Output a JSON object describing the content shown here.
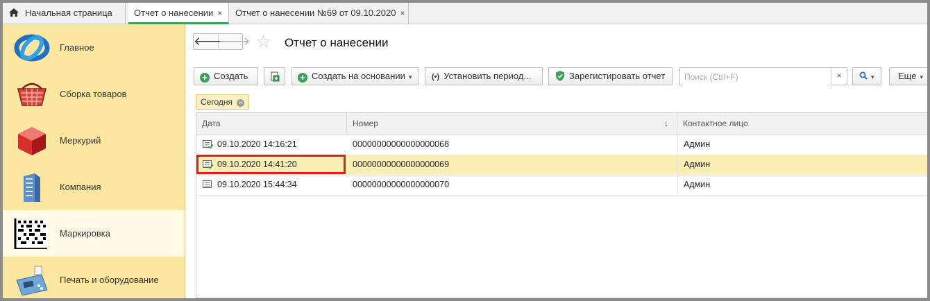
{
  "tabs": [
    {
      "label": "Начальная страница",
      "icon": "home-icon"
    },
    {
      "label": "Отчет о нанесении",
      "active": true
    },
    {
      "label": "Отчет о нанесении №69 от 09.10.2020"
    }
  ],
  "tab_close": "×",
  "sidebar": {
    "items": [
      {
        "label": "Главное",
        "icon": "main-swirl-icon"
      },
      {
        "label": "Сборка товаров",
        "icon": "basket-icon"
      },
      {
        "label": "Меркурий",
        "icon": "red-cube-icon"
      },
      {
        "label": "Компания",
        "icon": "building-icon"
      },
      {
        "label": "Маркировка",
        "icon": "datamatrix-icon",
        "selected": true
      },
      {
        "label": "Печать и оборудование",
        "icon": "cash-register-icon"
      }
    ]
  },
  "header": {
    "title": "Отчет о нанесении",
    "back": "🡐",
    "forward": "🡒",
    "star": "☆"
  },
  "toolbar": {
    "create": "Создать",
    "create_based": "Создать на основании",
    "set_period": "Установить период...",
    "register": "Зарегистировать отчет",
    "search_placeholder": "Поиск (Ctrl+F)",
    "search_clear": "×",
    "more": "Еще",
    "caret": "▾"
  },
  "filter": {
    "label": "Сегодня",
    "remove": "×"
  },
  "table": {
    "columns": [
      "Дата",
      "Номер",
      "Контактное лицо"
    ],
    "sort_indicator": "↓",
    "rows": [
      {
        "date": "09.10.2020 14:16:21",
        "number": "00000000000000000068",
        "contact": "Админ",
        "posted": true
      },
      {
        "date": "09.10.2020 14:41:20",
        "number": "00000000000000000069",
        "contact": "Админ",
        "posted": true,
        "selected": true
      },
      {
        "date": "09.10.2020 15:44:34",
        "number": "00000000000000000070",
        "contact": "Админ",
        "posted": false
      }
    ]
  },
  "colors": {
    "sidebar_bg": "#fbe7a0",
    "accent_green": "#3aa05a",
    "selected_row": "#fcefb4",
    "focus_border": "#e01e1e"
  }
}
